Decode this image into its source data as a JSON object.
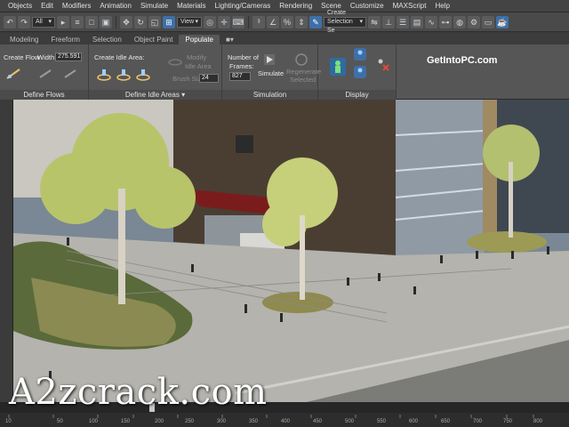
{
  "menu": [
    "Objects",
    "Edit",
    "Modifiers",
    "Animation",
    "Simulate",
    "Materials",
    "Lighting/Cameras",
    "Rendering",
    "Scene",
    "Customize",
    "MAXScript",
    "Help"
  ],
  "toolbar": {
    "selection_filter": "All",
    "view_select": "View",
    "selection_set": "Create Selection Se"
  },
  "ribbon_tabs": [
    "Modeling",
    "Freeform",
    "Selection",
    "Object Paint",
    "Populate"
  ],
  "active_tab": "Populate",
  "groups": {
    "define_flows": {
      "title": "Define Flows",
      "create_flow": "Create Flow",
      "width_label": "Width:",
      "width_value": "275.591"
    },
    "define_idle": {
      "title": "Define Idle Areas",
      "create_idle": "Create Idle Area:",
      "modify": "Modify",
      "idle_area": "Idle Area",
      "brush_size_label": "Brush Size:",
      "brush_size_value": "24"
    },
    "simulation": {
      "title": "Simulation",
      "number_label": "Number of",
      "frames_label": "Frames:",
      "frames_value": "827",
      "simulate": "Simulate",
      "regenerate": "Regenerate",
      "selected": "Selected"
    },
    "display": {
      "title": "Display"
    }
  },
  "brand_text": "GetIntoPC.com",
  "watermark": "A2zcrack.com",
  "timeline": {
    "labels": [
      "10",
      "50",
      "100",
      "150",
      "200",
      "250",
      "300",
      "350",
      "400",
      "450",
      "500",
      "550",
      "600",
      "650",
      "700",
      "750",
      "800"
    ]
  },
  "colors": {
    "accent": "#3f6fa8",
    "ribbon": "#565656",
    "menubar": "#444444"
  }
}
